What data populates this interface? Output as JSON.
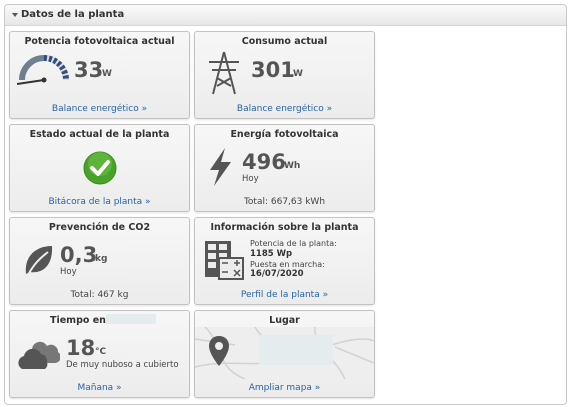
{
  "panel": {
    "title": "Datos de la planta"
  },
  "cards": {
    "pv_power": {
      "title": "Potencia fotovoltaica actual",
      "value": "33",
      "unit": "W",
      "link": "Balance energético »"
    },
    "consumption": {
      "title": "Consumo actual",
      "value": "301",
      "unit": "W",
      "link": "Balance energético »"
    },
    "plant_status": {
      "title": "Estado actual de la planta",
      "link": "Bitácora de la planta »"
    },
    "pv_energy": {
      "title": "Energía fotovoltaica",
      "value": "496",
      "unit": "Wh",
      "period": "Hoy",
      "total": "Total: 667,63 kWh"
    },
    "co2": {
      "title": "Prevención de CO2",
      "value": "0,3",
      "unit": "kg",
      "period": "Hoy",
      "total": "Total: 467 kg"
    },
    "plant_info": {
      "title": "Información sobre la planta",
      "power_label": "Potencia de la planta:",
      "power_value": "1185 Wp",
      "commission_label": "Puesta en marcha:",
      "commission_value": "16/07/2020",
      "link": "Perfil de la planta »"
    },
    "weather": {
      "title": "Tiempo en",
      "value": "18",
      "unit": "°C",
      "condition": "De muy nuboso a cubierto",
      "link": "Mañana »"
    },
    "location": {
      "title": "Lugar",
      "link": "Ampliar mapa »"
    }
  },
  "colors": {
    "link": "#2763a8",
    "ok_green": "#4aa329",
    "value_gray": "#555555"
  }
}
